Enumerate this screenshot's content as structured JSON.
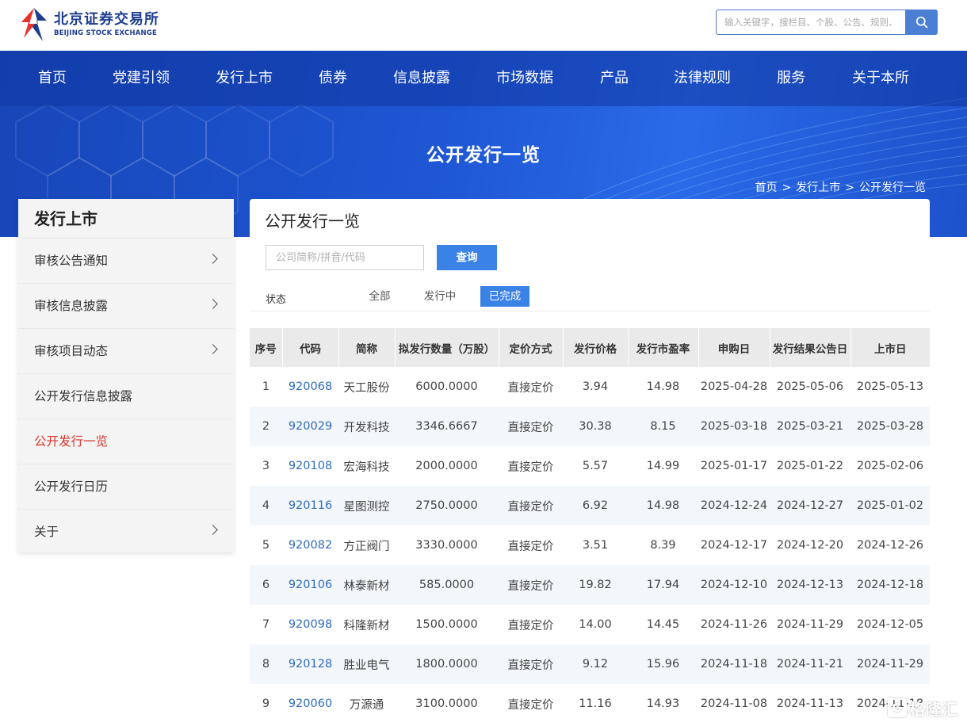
{
  "header": {
    "logo_cn": "北京证券交易所",
    "logo_en": "BEIJING STOCK EXCHANGE",
    "search_placeholder": "输入关键字，搜栏目、个股、公告、规则、",
    "search_icon": "search-icon"
  },
  "nav": {
    "items": [
      "首页",
      "党建引领",
      "发行上市",
      "债券",
      "信息披露",
      "市场数据",
      "产品",
      "法律规则",
      "服务",
      "关于本所"
    ]
  },
  "banner": {
    "title": "公开发行一览",
    "breadcrumb": [
      "首页",
      "发行上市",
      "公开发行一览"
    ],
    "breadcrumb_sep": ">"
  },
  "sidebar": {
    "title": "发行上市",
    "items": [
      {
        "label": "审核公告通知",
        "has_chevron": true,
        "active": false
      },
      {
        "label": "审核信息披露",
        "has_chevron": true,
        "active": false
      },
      {
        "label": "审核项目动态",
        "has_chevron": true,
        "active": false
      },
      {
        "label": "公开发行信息披露",
        "has_chevron": false,
        "active": false
      },
      {
        "label": "公开发行一览",
        "has_chevron": false,
        "active": true
      },
      {
        "label": "公开发行日历",
        "has_chevron": false,
        "active": false
      },
      {
        "label": "关于",
        "has_chevron": true,
        "active": false
      }
    ],
    "active_color": "#d9342b"
  },
  "main": {
    "title": "公开发行一览",
    "query_placeholder": "公司简称/拼音/代码",
    "query_button": "查询",
    "status_label": "状态",
    "filters": [
      {
        "label": "全部",
        "active": false
      },
      {
        "label": "发行中",
        "active": false
      },
      {
        "label": "已完成",
        "active": true
      }
    ],
    "accent_color": "#3b82e7",
    "table": {
      "columns": [
        "序号",
        "代码",
        "简称",
        "拟发行数量（万股）",
        "定价方式",
        "发行价格",
        "发行市盈率",
        "申购日",
        "发行结果公告日",
        "上市日"
      ],
      "rows": [
        [
          "1",
          "920068",
          "天工股份",
          "6000.0000",
          "直接定价",
          "3.94",
          "14.98",
          "2025-04-28",
          "2025-05-06",
          "2025-05-13"
        ],
        [
          "2",
          "920029",
          "开发科技",
          "3346.6667",
          "直接定价",
          "30.38",
          "8.15",
          "2025-03-18",
          "2025-03-21",
          "2025-03-28"
        ],
        [
          "3",
          "920108",
          "宏海科技",
          "2000.0000",
          "直接定价",
          "5.57",
          "14.99",
          "2025-01-17",
          "2025-01-22",
          "2025-02-06"
        ],
        [
          "4",
          "920116",
          "星图测控",
          "2750.0000",
          "直接定价",
          "6.92",
          "14.98",
          "2024-12-24",
          "2024-12-27",
          "2025-01-02"
        ],
        [
          "5",
          "920082",
          "方正阀门",
          "3330.0000",
          "直接定价",
          "3.51",
          "8.39",
          "2024-12-17",
          "2024-12-20",
          "2024-12-26"
        ],
        [
          "6",
          "920106",
          "林泰新材",
          "585.0000",
          "直接定价",
          "19.82",
          "17.94",
          "2024-12-10",
          "2024-12-13",
          "2024-12-18"
        ],
        [
          "7",
          "920098",
          "科隆新材",
          "1500.0000",
          "直接定价",
          "14.00",
          "14.45",
          "2024-11-26",
          "2024-11-29",
          "2024-12-05"
        ],
        [
          "8",
          "920128",
          "胜业电气",
          "1800.0000",
          "直接定价",
          "9.12",
          "15.96",
          "2024-11-18",
          "2024-11-21",
          "2024-11-29"
        ],
        [
          "9",
          "920060",
          "万源通",
          "3100.0000",
          "直接定价",
          "11.16",
          "14.93",
          "2024-11-08",
          "2024-11-13",
          "2024-11-18"
        ]
      ]
    }
  },
  "watermark": {
    "text": "格隆汇",
    "mark": "G"
  }
}
